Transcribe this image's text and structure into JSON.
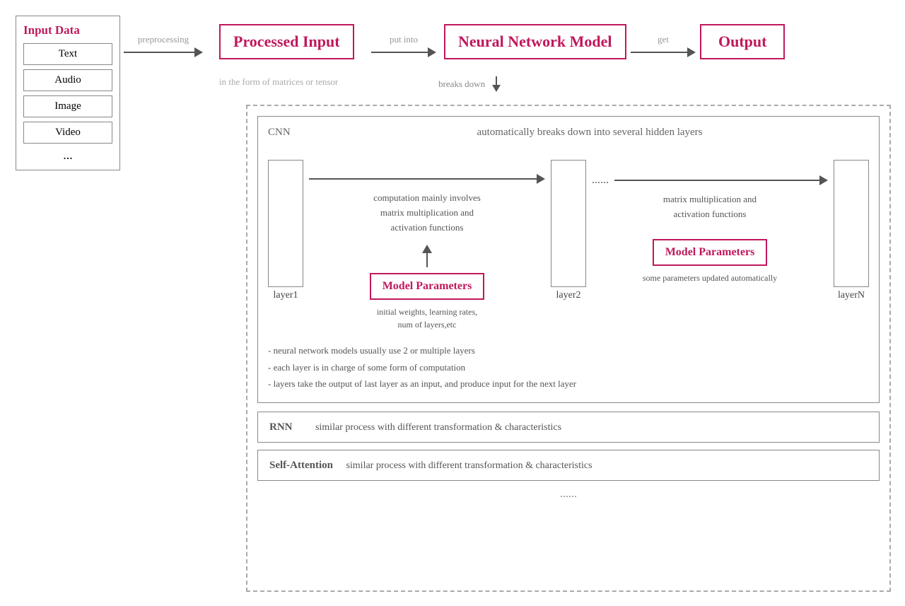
{
  "inputData": {
    "title": "Input Data",
    "items": [
      "Text",
      "Audio",
      "Image",
      "Video",
      "..."
    ]
  },
  "topFlow": {
    "preprocessing_label": "preprocessing",
    "processed_input_label": "Processed Input",
    "put_into_label": "put into",
    "nn_model_label": "Neural Network Model",
    "get_label": "get",
    "output_label": "Output",
    "subtitle": "in the form of matrices or tensor",
    "breaks_down_label": "breaks down"
  },
  "cnnBox": {
    "label": "CNN",
    "top_description": "automatically breaks down into several hidden layers",
    "layer1_label": "layer1",
    "layer2_label": "layer2",
    "layerN_label": "layerN",
    "dots_label": "......",
    "computation_text": "computation mainly involves\nmatrix multiplication and\nactivation functions",
    "right_computation_text": "matrix multiplication and\nactivation functions",
    "model_params_label": "Model Parameters",
    "initial_weights_text": "initial weights, learning rates,\nnum of layers,etc",
    "some_params_text": "some parameters\nupdated automatically",
    "notes": [
      "- neural network models usually use 2 or multiple layers",
      "- each layer is in charge of some form of computation",
      "- layers take the output of last layer as an input, and produce input for the next layer"
    ]
  },
  "rnnBox": {
    "label": "RNN",
    "description": "similar process with different transformation & characteristics"
  },
  "saBox": {
    "label": "Self-Attention",
    "description": "similar process with different transformation & characteristics"
  },
  "bottomDots": "......"
}
